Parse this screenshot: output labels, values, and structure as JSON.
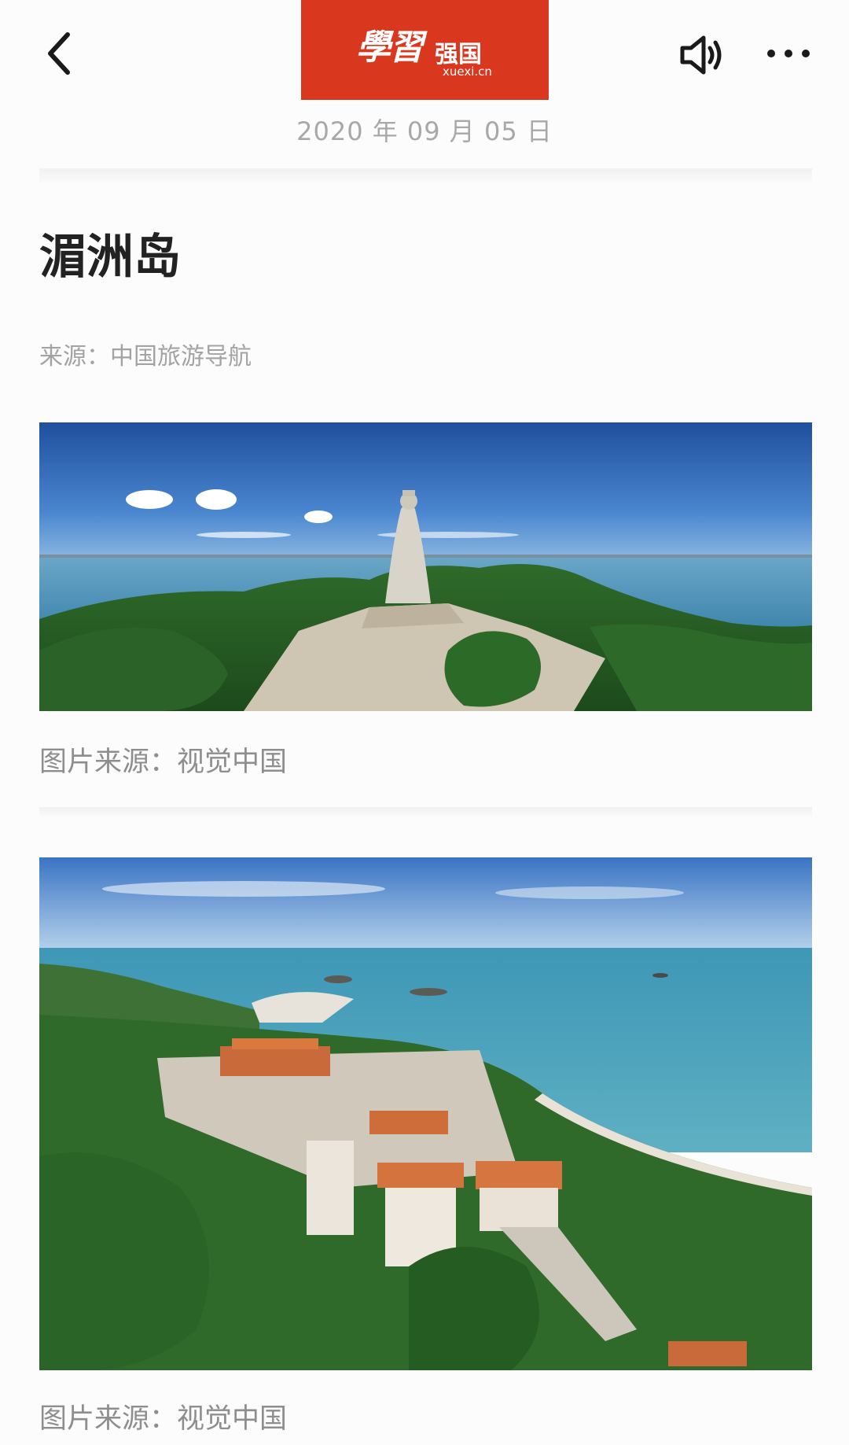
{
  "header": {
    "logo_calligraphy": "學習",
    "logo_brand": "强国",
    "logo_domain": "xuexi.cn",
    "date": "2020 年 09 月 05 日"
  },
  "article": {
    "title": "湄洲岛",
    "source": "来源：中国旅游导航",
    "images": [
      {
        "caption": "图片来源：视觉中国"
      },
      {
        "caption": "图片来源：视觉中国"
      }
    ]
  },
  "icons": {
    "back": "chevron-left-icon",
    "speaker": "speaker-icon",
    "more": "more-dots-icon"
  },
  "colors": {
    "brand_red": "#d9381e",
    "date_gray": "#a8a8a8",
    "title": "#222222",
    "caption_gray": "#8e8e8e"
  }
}
